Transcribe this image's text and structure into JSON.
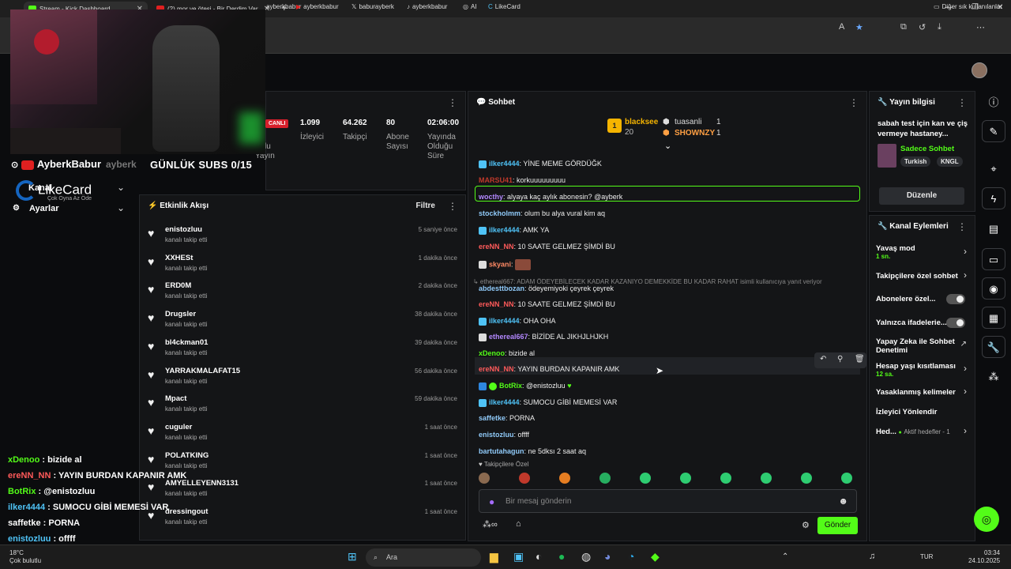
{
  "browser": {
    "tabs": [
      {
        "label": "Stream - Kick Dashboard"
      },
      {
        "label": "(2) mor ve ötesi - Bir Derdim Var"
      }
    ],
    "bookmarks": [
      "ayberkbabur",
      "ayberkbabur",
      "baburayberk",
      "ayberkbabur",
      "AI",
      "LikeCard"
    ],
    "other_bookmarks": "Diğer sık kullanılanlar"
  },
  "stream_overlay": {
    "name": "AyberkBabur",
    "name_shadow": "ayberk",
    "subs_goal": "GÜNLÜK SUBS 0/15",
    "likecard": "LikeCard",
    "likecard_tag": "Çok Oyna Az Öde",
    "sidebar_kanal": "Kanal",
    "sidebar_ayarlar": "Ayarlar"
  },
  "stats": {
    "live_badge": "CANLI",
    "items": [
      {
        "value": "1.099",
        "label": "İzleyici"
      },
      {
        "value": "64.262",
        "label": "Takipçi"
      },
      {
        "value": "80",
        "label": "Abone Sayısı"
      },
      {
        "value": "02:06:00",
        "label": "Yayında Olduğu Süre"
      }
    ],
    "partial_labels": [
      "lu",
      "Yayın"
    ]
  },
  "activity": {
    "title": "Etkinlik Akışı",
    "filter_label": "Filtre",
    "action_text": "kanalı takip etti",
    "items": [
      {
        "name": "enistozluu",
        "time": "5 saniye önce"
      },
      {
        "name": "XXHESt",
        "time": "1 dakika önce"
      },
      {
        "name": "ERD0M",
        "time": "2 dakika önce"
      },
      {
        "name": "Drugsler",
        "time": "38 dakika önce"
      },
      {
        "name": "bl4ckman01",
        "time": "39 dakika önce"
      },
      {
        "name": "YARRAKMALAFAT15",
        "time": "56 dakika önce"
      },
      {
        "name": "Mpact",
        "time": "59 dakika önce"
      },
      {
        "name": "cuguler",
        "time": "1 saat önce"
      },
      {
        "name": "POLATKING",
        "time": "1 saat önce"
      },
      {
        "name": "AMYELLEYENN3131",
        "time": "1 saat önce"
      },
      {
        "name": "dressingout",
        "time": "1 saat önce"
      }
    ]
  },
  "left_chat": [
    {
      "user": "xDenoo",
      "text": " : bizide al",
      "color": "#53fc18"
    },
    {
      "user": "ereNN_NN",
      "text": " : YAYIN BURDAN KAPANIR AMK",
      "color": "#ff5a5a"
    },
    {
      "user": "BotRix",
      "text": " : @enistozluu",
      "color": "#53fc18"
    },
    {
      "user": "ilker4444",
      "text": " : SUMOCU GİBİ MEMESİ VAR",
      "color": "#4fc3f7"
    },
    {
      "user": "saffetke",
      "text": " : PORNA",
      "color": "#ffffff"
    },
    {
      "user": "enistozluu",
      "text": " : offff",
      "color": "#4fc3f7"
    }
  ],
  "chat": {
    "title": "Sohbet",
    "leaderboard": {
      "first_name": "blacksee",
      "first_count": "20",
      "second_name": "tuasanli",
      "second_count": "1",
      "third_name": "SHOWNZY",
      "third_count": "1"
    },
    "messages": [
      {
        "user": "ilker4444",
        "text": ": YİNE MEME GÖRDÜĞK",
        "color": "#4fc3f7"
      },
      {
        "user": "MARSU41",
        "text": ": korkuuuuuuuuu",
        "color": "#c0392b"
      },
      {
        "user": "wocthy",
        "text": ": alyaya kaç aylık abonesin? @ayberk",
        "color": "#b388ff"
      },
      {
        "user": "stockholmm",
        "text": ": olum bu alya vural kim aq",
        "color": "#90caf9"
      },
      {
        "user": "ilker4444",
        "text": ": AMK YA",
        "color": "#4fc3f7"
      },
      {
        "user": "ereNN_NN",
        "text": ": 10 SAATE GELMEZ ŞİMDİ BU",
        "color": "#ff5a5a"
      },
      {
        "user": "skyani",
        "text": ":",
        "color": "#ff8a65"
      },
      {
        "user": "abdesttbozan",
        "text": ": ödeyemiyoki çeyrek çeyrek",
        "color": "#90caf9"
      },
      {
        "user": "ereNN_NN",
        "text": ": 10 SAATE GELMEZ ŞİMDİ BU",
        "color": "#ff5a5a"
      },
      {
        "user": "ilker4444",
        "text": ": OHA OHA",
        "color": "#4fc3f7"
      },
      {
        "user": "ethereal667",
        "text": ": BİZİDE AL JIKHJLHJKH",
        "color": "#b388ff"
      },
      {
        "user": "xDenoo",
        "text": ": bizide al",
        "color": "#53fc18"
      },
      {
        "user": "ereNN_NN",
        "text": ": YAYIN BURDAN KAPANIR AMK",
        "color": "#ff5a5a"
      },
      {
        "user": "BotRix",
        "text": ": @enistozluu",
        "color": "#53fc18"
      },
      {
        "user": "ilker4444",
        "text": ": SUMOCU GİBİ MEMESİ VAR",
        "color": "#4fc3f7"
      },
      {
        "user": "saffetke",
        "text": ": PORNA",
        "color": "#90caf9"
      },
      {
        "user": "enistozluu",
        "text": ": offff",
        "color": "#90caf9"
      },
      {
        "user": "bartutahagun",
        "text": ": ne 5dksı 2 saat aq",
        "color": "#90caf9"
      }
    ],
    "reply_note": "↳ ethereal667: ADAM ÖDEYEBİLECEK KADAR KAZANIYO DEMEKKİDE BU KADAR RAHAT isimli kullanıcıya yanıt veriyor",
    "followers_only": "Takipçilere Özel",
    "input_placeholder": "Bir mesaj gönderin",
    "send_label": "Gönder"
  },
  "stream_info": {
    "title": "Yayın bilgisi",
    "stream_title": "sabah test için kan ve çiş vermeye hastaney...",
    "category": "Sadece Sohbet",
    "tags": [
      "Turkish",
      "KNGL"
    ],
    "edit_label": "Düzenle"
  },
  "channel_actions": {
    "title": "Kanal Eylemleri",
    "items": [
      {
        "label": "Yavaş mod",
        "sub": "1 sn."
      },
      {
        "label": "Takipçilere özel sohbet",
        "sub": ""
      },
      {
        "label": "Abonelere özel...",
        "sub": ""
      },
      {
        "label": "Yalnızca ifadelerie...",
        "sub": ""
      },
      {
        "label": "Yapay Zeka ile Sohbet Denetimi",
        "sub": ""
      },
      {
        "label": "Hesap yaşı kısıtlaması",
        "sub": "12 sa."
      },
      {
        "label": "Yasaklanmış kelimeler",
        "sub": ""
      },
      {
        "label": "İzleyici Yönlendir",
        "sub": ""
      },
      {
        "label": "Hed...",
        "sub": "Aktif hedefler - 1"
      }
    ]
  },
  "taskbar": {
    "weather_temp": "18°C",
    "weather_desc": "Çok bulutlu",
    "search": "Ara",
    "lang": "TUR",
    "time": "03:34",
    "date": "24.10.2025"
  }
}
